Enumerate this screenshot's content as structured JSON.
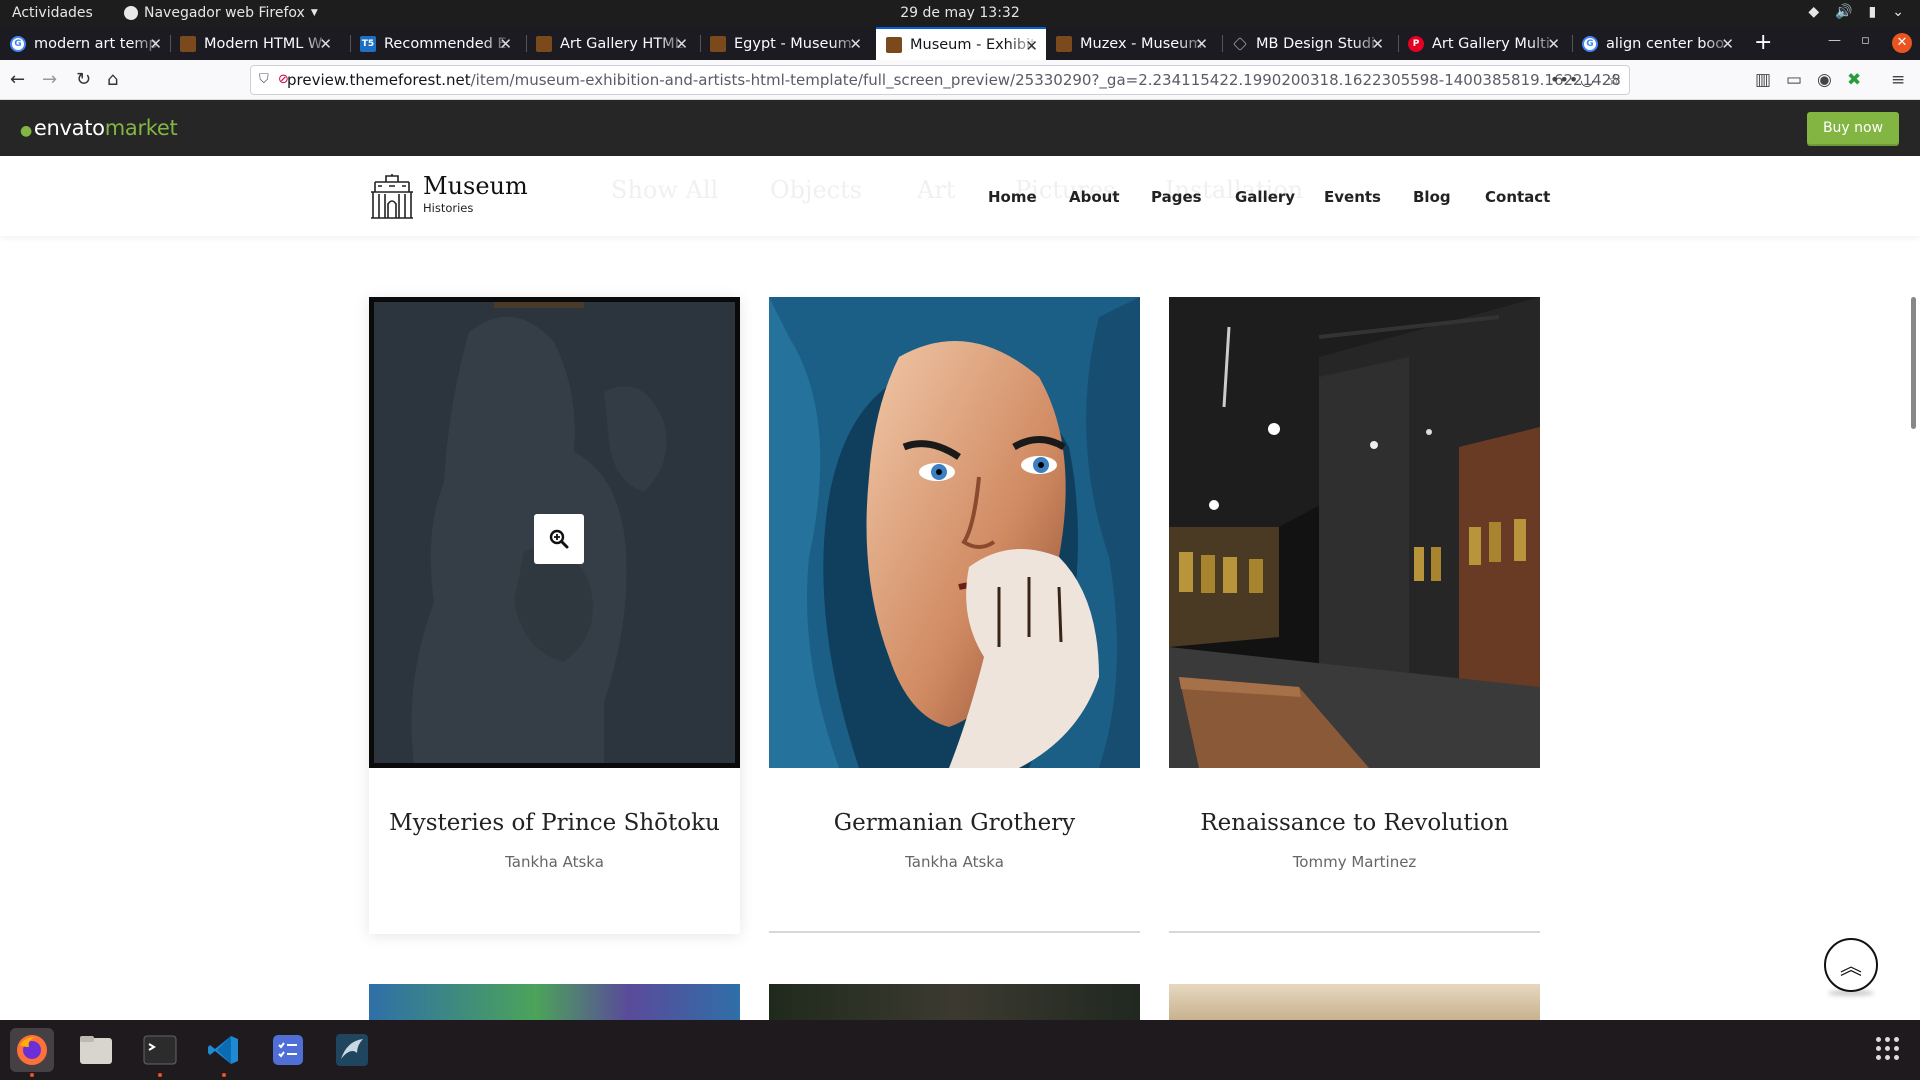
{
  "system": {
    "activities": "Actividades",
    "app_name": "Navegador web Firefox",
    "clock": "29 de may  13:32"
  },
  "tabs": [
    {
      "title": "modern art temp",
      "favicon": "google-icon"
    },
    {
      "title": "Modern HTML W",
      "favicon": "museum-icon"
    },
    {
      "title": "Recommended E",
      "favicon": "t5-icon"
    },
    {
      "title": "Art Gallery HTML",
      "favicon": "museum-icon"
    },
    {
      "title": "Egypt - Museum",
      "favicon": "museum-icon"
    },
    {
      "title": "Museum - Exhibit",
      "favicon": "museum-icon",
      "active": true
    },
    {
      "title": "Muzex - Museum",
      "favicon": "museum-icon"
    },
    {
      "title": "MB Design Studi",
      "favicon": "diamond-icon"
    },
    {
      "title": "Art Gallery Multi",
      "favicon": "pinterest-icon"
    },
    {
      "title": "align center boo",
      "favicon": "google-icon"
    }
  ],
  "url": {
    "host": "preview.themeforest.net",
    "path": "/item/museum-exhibition-and-artists-html-template/full_screen_preview/25330290?_ga=2.234115422.1990200318.1622305598-1400385819.16221428"
  },
  "envato": {
    "logo_main": "envato",
    "logo_market": "market",
    "buy_now": "Buy now"
  },
  "site": {
    "logo_title": "Museum",
    "logo_sub": "Histories",
    "ghost_filters": [
      "Show All",
      "Objects",
      "Art",
      "Pictures",
      "Installation"
    ],
    "nav": [
      "Home",
      "About",
      "Pages",
      "Gallery",
      "Events",
      "Blog",
      "Contact"
    ]
  },
  "gallery": [
    {
      "title": "Mysteries of Prince Shōtoku",
      "artist": "Tankha Atska"
    },
    {
      "title": "Germanian Grothery",
      "artist": "Tankha Atska"
    },
    {
      "title": "Renaissance to Revolution",
      "artist": "Tommy Martinez"
    }
  ],
  "colors": {
    "envato_green": "#82b541",
    "browser_accent": "#0060df",
    "ubuntu_orange": "#e95420"
  }
}
